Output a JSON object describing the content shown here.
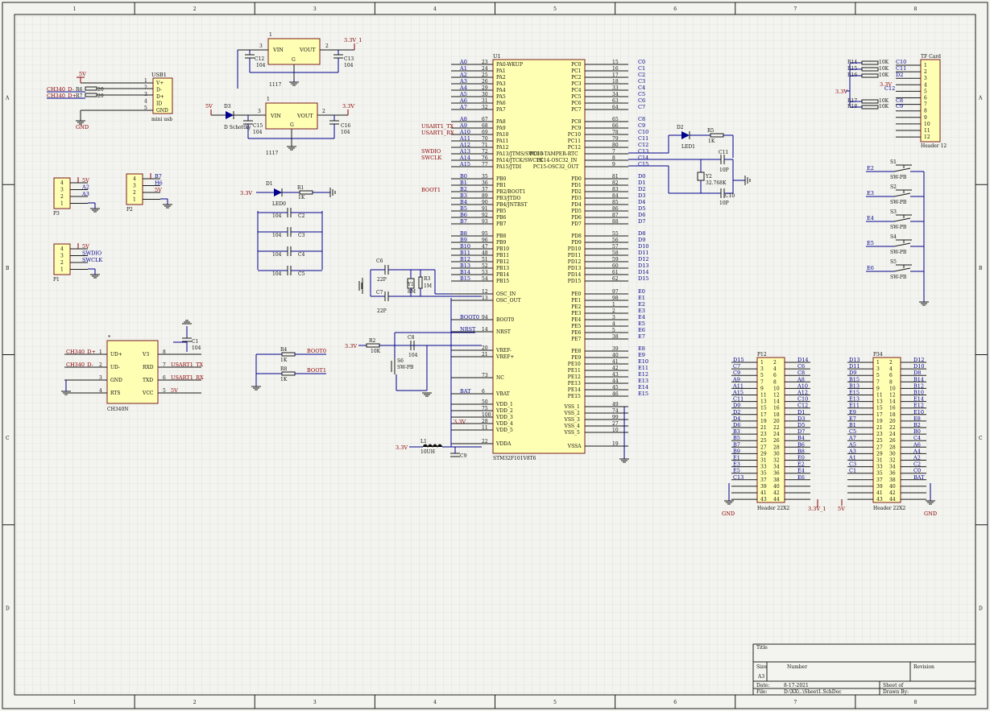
{
  "border": {
    "columns": [
      "1",
      "2",
      "3",
      "4",
      "5",
      "6",
      "7",
      "8"
    ],
    "rows": [
      "A",
      "B",
      "C",
      "D"
    ]
  },
  "title_block": {
    "title_label": "Title",
    "size_label": "Size",
    "size_value": "A3",
    "number_label": "Number",
    "revision_label": "Revision",
    "date_label": "Date:",
    "date_value": "8-17-2021",
    "file_label": "File:",
    "file_value": "D:\\XX\\..\\Sheet1.SchDoc",
    "sheet_label": "Sheet   of",
    "drawn_label": "Drawn By:"
  },
  "mcu": {
    "designator": "U1",
    "part": "STM32F101V8T6",
    "left_pins": [
      {
        "num": "23",
        "name": "PA0-WKUP",
        "net": "A0"
      },
      {
        "num": "24",
        "name": "PA1",
        "net": "A1"
      },
      {
        "num": "25",
        "name": "PA2",
        "net": "A2"
      },
      {
        "num": "26",
        "name": "PA3",
        "net": "A3"
      },
      {
        "num": "29",
        "name": "PA4",
        "net": "A4"
      },
      {
        "num": "30",
        "name": "PA5",
        "net": "A5"
      },
      {
        "num": "31",
        "name": "PA6",
        "net": "A6"
      },
      {
        "num": "32",
        "name": "PA7",
        "net": "A7"
      },
      {
        "num": "67",
        "name": "PA8",
        "net": "A8"
      },
      {
        "num": "68",
        "name": "PA9",
        "net": "A9"
      },
      {
        "num": "69",
        "name": "PA10",
        "net": "A10"
      },
      {
        "num": "70",
        "name": "PA11",
        "net": "A11"
      },
      {
        "num": "71",
        "name": "PA12",
        "net": "A12"
      },
      {
        "num": "72",
        "name": "PA13/JTMS/SWDIO",
        "net": "A13"
      },
      {
        "num": "76",
        "name": "PA14/JTCK/SWCLK",
        "net": "A14"
      },
      {
        "num": "77",
        "name": "PA15/JTDI",
        "net": "A15"
      },
      {
        "num": "35",
        "name": "PB0",
        "net": "B0"
      },
      {
        "num": "36",
        "name": "PB1",
        "net": "B1"
      },
      {
        "num": "37",
        "name": "PB2/BOOT1",
        "net": "B2"
      },
      {
        "num": "89",
        "name": "PB3/JTDO",
        "net": "B3"
      },
      {
        "num": "90",
        "name": "PB4/JNTRST",
        "net": "B4"
      },
      {
        "num": "91",
        "name": "PB5",
        "net": "B5"
      },
      {
        "num": "92",
        "name": "PB6",
        "net": "B6"
      },
      {
        "num": "93",
        "name": "PB7",
        "net": "B7"
      },
      {
        "num": "95",
        "name": "PB8",
        "net": "B8"
      },
      {
        "num": "96",
        "name": "PB9",
        "net": "B9"
      },
      {
        "num": "47",
        "name": "PB10",
        "net": "B10"
      },
      {
        "num": "48",
        "name": "PB11",
        "net": "B11"
      },
      {
        "num": "51",
        "name": "PB12",
        "net": "B12"
      },
      {
        "num": "52",
        "name": "PB13",
        "net": "B13"
      },
      {
        "num": "53",
        "name": "PB14",
        "net": "B14"
      },
      {
        "num": "54",
        "name": "PB15",
        "net": "B15"
      },
      {
        "num": "12",
        "name": "OSC_IN",
        "net": ""
      },
      {
        "num": "13",
        "name": "OSC_OUT",
        "net": ""
      },
      {
        "num": "94",
        "name": "BOOT0",
        "net": "BOOT0"
      },
      {
        "num": "14",
        "name": "NRST",
        "net": "NRST"
      },
      {
        "num": "20",
        "name": "VREF-",
        "net": ""
      },
      {
        "num": "21",
        "name": "VREF+",
        "net": ""
      },
      {
        "num": "73",
        "name": "NC",
        "net": ""
      },
      {
        "num": "6",
        "name": "VBAT",
        "net": "BAT"
      },
      {
        "num": "50",
        "name": "VDD_1",
        "net": ""
      },
      {
        "num": "75",
        "name": "VDD_2",
        "net": ""
      },
      {
        "num": "100",
        "name": "VDD_3",
        "net": ""
      },
      {
        "num": "28",
        "name": "VDD_4",
        "net": ""
      },
      {
        "num": "11",
        "name": "VDD_5",
        "net": ""
      },
      {
        "num": "22",
        "name": "VDDA",
        "net": ""
      }
    ],
    "right_pins": [
      {
        "num": "15",
        "name": "PC0",
        "net": "C0"
      },
      {
        "num": "16",
        "name": "PC1",
        "net": "C1"
      },
      {
        "num": "17",
        "name": "PC2",
        "net": "C2"
      },
      {
        "num": "18",
        "name": "PC3",
        "net": "C3"
      },
      {
        "num": "33",
        "name": "PC4",
        "net": "C4"
      },
      {
        "num": "34",
        "name": "PC5",
        "net": "C5"
      },
      {
        "num": "63",
        "name": "PC6",
        "net": "C6"
      },
      {
        "num": "64",
        "name": "PC7",
        "net": "C7"
      },
      {
        "num": "65",
        "name": "PC8",
        "net": "C8"
      },
      {
        "num": "66",
        "name": "PC9",
        "net": "C9"
      },
      {
        "num": "78",
        "name": "PC10",
        "net": "C10"
      },
      {
        "num": "79",
        "name": "PC11",
        "net": "C11"
      },
      {
        "num": "80",
        "name": "PC12",
        "net": "C12"
      },
      {
        "num": "7",
        "name": "PC13-TAMPER-RTC",
        "net": "C13"
      },
      {
        "num": "8",
        "name": "PC14-OSC32_IN",
        "net": "C14"
      },
      {
        "num": "9",
        "name": "PC15-OSC32_OUT",
        "net": "C15"
      },
      {
        "num": "81",
        "name": "PD0",
        "net": "D0"
      },
      {
        "num": "82",
        "name": "PD1",
        "net": "D1"
      },
      {
        "num": "83",
        "name": "PD2",
        "net": "D2"
      },
      {
        "num": "84",
        "name": "PD3",
        "net": "D3"
      },
      {
        "num": "85",
        "name": "PD4",
        "net": "D4"
      },
      {
        "num": "86",
        "name": "PD5",
        "net": "D5"
      },
      {
        "num": "87",
        "name": "PD6",
        "net": "D6"
      },
      {
        "num": "88",
        "name": "PD7",
        "net": "D7"
      },
      {
        "num": "55",
        "name": "PD8",
        "net": "D8"
      },
      {
        "num": "56",
        "name": "PD9",
        "net": "D9"
      },
      {
        "num": "57",
        "name": "PD10",
        "net": "D10"
      },
      {
        "num": "58",
        "name": "PD11",
        "net": "D11"
      },
      {
        "num": "59",
        "name": "PD12",
        "net": "D12"
      },
      {
        "num": "60",
        "name": "PD13",
        "net": "D13"
      },
      {
        "num": "61",
        "name": "PD14",
        "net": "D14"
      },
      {
        "num": "62",
        "name": "PD15",
        "net": "D15"
      },
      {
        "num": "97",
        "name": "PE0",
        "net": "E0"
      },
      {
        "num": "98",
        "name": "PE1",
        "net": "E1"
      },
      {
        "num": "1",
        "name": "PE2",
        "net": "E2"
      },
      {
        "num": "2",
        "name": "PE3",
        "net": "E3"
      },
      {
        "num": "3",
        "name": "PE4",
        "net": "E4"
      },
      {
        "num": "4",
        "name": "PE5",
        "net": "E5"
      },
      {
        "num": "5",
        "name": "PE6",
        "net": "E6"
      },
      {
        "num": "38",
        "name": "PE7",
        "net": "E7"
      },
      {
        "num": "39",
        "name": "PE8",
        "net": "E8"
      },
      {
        "num": "40",
        "name": "PE9",
        "net": "E9"
      },
      {
        "num": "41",
        "name": "PE10",
        "net": "E10"
      },
      {
        "num": "42",
        "name": "PE11",
        "net": "E11"
      },
      {
        "num": "43",
        "name": "PE12",
        "net": "E12"
      },
      {
        "num": "44",
        "name": "PE13",
        "net": "E13"
      },
      {
        "num": "45",
        "name": "PE14",
        "net": "E14"
      },
      {
        "num": "46",
        "name": "PE15",
        "net": "E15"
      },
      {
        "num": "49",
        "name": "VSS_1",
        "net": ""
      },
      {
        "num": "74",
        "name": "VSS_2",
        "net": ""
      },
      {
        "num": "99",
        "name": "VSS_3",
        "net": ""
      },
      {
        "num": "27",
        "name": "VSS_4",
        "net": ""
      },
      {
        "num": "10",
        "name": "VSS_5",
        "net": ""
      },
      {
        "num": "19",
        "name": "VSSA",
        "net": ""
      }
    ],
    "side_labels": {
      "usart_tx": "USART1_TX",
      "usart_rx": "USART1_RX",
      "swdio": "SWDIO",
      "swclk": "SWCLK",
      "boot1": "BOOT1",
      "boot0": "BOOT0",
      "nrst": "NRST",
      "bat": "BAT"
    }
  },
  "usb": {
    "designator": "USB1",
    "value": "mini usb",
    "pins": [
      "V+",
      "D-",
      "D+",
      "ID",
      "GND"
    ],
    "pin_nums": [
      "1",
      "2",
      "3",
      "4",
      "5"
    ],
    "net_dm": "CH340_D-",
    "net_dp": "CH340_D+",
    "r6": "R6",
    "r7": "R7",
    "r_value": "20",
    "vcc": "5V",
    "gnd": "GND"
  },
  "regulator1": {
    "part": "1117",
    "vin": "VIN",
    "vout": "VOUT",
    "g": "G",
    "pin_in": "3",
    "pin_out": "2",
    "pin_top": "1",
    "cin": "C12",
    "cout": "C13",
    "cval": "104",
    "out_net": "3.3V_1"
  },
  "regulator2": {
    "part": "1117",
    "vin": "VIN",
    "vout": "VOUT",
    "g": "G",
    "pin_in": "3",
    "pin_out": "2",
    "pin_top": "1",
    "cin": "C15",
    "cout": "C16",
    "cval": "104",
    "out_net": "3.3V",
    "in_net": "5V",
    "diode": "D3",
    "diode_val": "D Schottky"
  },
  "led0": {
    "diode": "D1",
    "diode_val": "LED0",
    "res": "R1",
    "res_val": "1K",
    "net": "3.3V"
  },
  "decoupling": [
    {
      "des": "C2",
      "val": "104"
    },
    {
      "des": "C3",
      "val": "104"
    },
    {
      "des": "C4",
      "val": "104"
    },
    {
      "des": "C5",
      "val": "104"
    }
  ],
  "crystal": {
    "c6": "C6",
    "c7": "C7",
    "cval": "22P",
    "y": "Y1",
    "yval": "8M",
    "r": "R3",
    "rval": "1M"
  },
  "boot": {
    "r4": "R4",
    "r8": "R8",
    "rval": "1K",
    "net0": "BOOT0",
    "net1": "BOOT1"
  },
  "reset": {
    "r2": "R2",
    "r2val": "10K",
    "c8": "C8",
    "c8val": "104",
    "sw": "S6",
    "swval": "SW-PB",
    "net": "3.3V"
  },
  "ch340": {
    "designator": "U?",
    "part": "CH340N",
    "star": "*",
    "left": [
      {
        "num": "1",
        "name": "UD+",
        "net": "CH340_D+"
      },
      {
        "num": "2",
        "name": "UD-",
        "net": "CH340_D-"
      },
      {
        "num": "3",
        "name": "GND",
        "net": ""
      },
      {
        "num": "4",
        "name": "RTS",
        "net": ""
      }
    ],
    "right": [
      {
        "num": "8",
        "name": "V3",
        "net": ""
      },
      {
        "num": "7",
        "name": "RXD",
        "net": "USART1_TX"
      },
      {
        "num": "6",
        "name": "TXD",
        "net": "USART1_RX"
      },
      {
        "num": "5",
        "name": "VCC",
        "net": "5V"
      }
    ],
    "c1": "C1",
    "c1val": "104"
  },
  "p3": {
    "des": "P3",
    "pins": [
      "4",
      "3",
      "2",
      "1"
    ],
    "nets": [
      "5V",
      "A2",
      "A3",
      ""
    ]
  },
  "p2": {
    "des": "P2",
    "pins": [
      "4",
      "3",
      "2",
      "1"
    ],
    "nets": [
      "B7",
      "H6",
      "5V",
      ""
    ]
  },
  "p1": {
    "des": "P1",
    "pins": [
      "4",
      "3",
      "2",
      "1"
    ],
    "nets": [
      "5V",
      "SWDIO",
      "SWCLK",
      ""
    ]
  },
  "vddnets": {
    "v33": "3.3V",
    "l1": "L1",
    "l1val": "10UH",
    "c9": "C9"
  },
  "rtc": {
    "led": "D2",
    "ledval": "LED1",
    "r5": "R5",
    "r5val": "1K",
    "y2": "Y2",
    "y2val": "32.768K",
    "c11": "C11",
    "c10": "C10",
    "cval": "10P"
  },
  "tfcard": {
    "des": "TF Card",
    "footer": "Header 12",
    "pins": [
      "1",
      "2",
      "3",
      "4",
      "5",
      "6",
      "7",
      "8",
      "9",
      "10",
      "11",
      "12"
    ],
    "r_des": [
      "R14",
      "R15",
      "R16",
      "R17",
      "R18"
    ],
    "r_val": "10K",
    "nets_top": [
      "C10",
      "C11",
      "D2"
    ],
    "nets_mid": [
      "C8",
      "C9"
    ],
    "net_v": "3.3V",
    "c12": "C12"
  },
  "switches": [
    {
      "des": "S1",
      "val": "SW-PB",
      "net": "E2"
    },
    {
      "des": "S2",
      "val": "SW-PB",
      "net": "E3"
    },
    {
      "des": "S3",
      "val": "SW-PB",
      "net": "E4"
    },
    {
      "des": "S4",
      "val": "SW-PB",
      "net": "E5"
    },
    {
      "des": "S5",
      "val": "SW-PB",
      "net": "E6"
    }
  ],
  "p12": {
    "des": "P12",
    "footer": "Header 22X2",
    "left": [
      "D15",
      "C7",
      "C9",
      "A9",
      "A11",
      "A15",
      "C11",
      "D0",
      "D2",
      "D4",
      "D6",
      "B3",
      "B5",
      "B7",
      "B9",
      "E1",
      "E3",
      "E5",
      "C13",
      "",
      "",
      ""
    ],
    "right": [
      "D14",
      "C6",
      "C8",
      "A8",
      "A10",
      "A12",
      "C10",
      "C12",
      "D1",
      "D3",
      "D5",
      "D7",
      "B4",
      "B6",
      "B8",
      "E0",
      "E2",
      "E4",
      "E6",
      "",
      "",
      ""
    ],
    "gnd": "GND",
    "v": "3.3V_1"
  },
  "p34": {
    "des": "P34",
    "footer": "Header 22X2",
    "left": [
      "D13",
      "D11",
      "D9",
      "B15",
      "B13",
      "E15",
      "E13",
      "E11",
      "E9",
      "E7",
      "B1",
      "C5",
      "A7",
      "A5",
      "A3",
      "A1",
      "C3",
      "C1",
      "",
      "",
      "",
      ""
    ],
    "right": [
      "D12",
      "D10",
      "D8",
      "B14",
      "B12",
      "B10",
      "E14",
      "E12",
      "E10",
      "E8",
      "B2",
      "B0",
      "C4",
      "A6",
      "A4",
      "A2",
      "C2",
      "C0",
      "BAT",
      "",
      "",
      ""
    ],
    "v": "5V",
    "gnd": "GND"
  }
}
